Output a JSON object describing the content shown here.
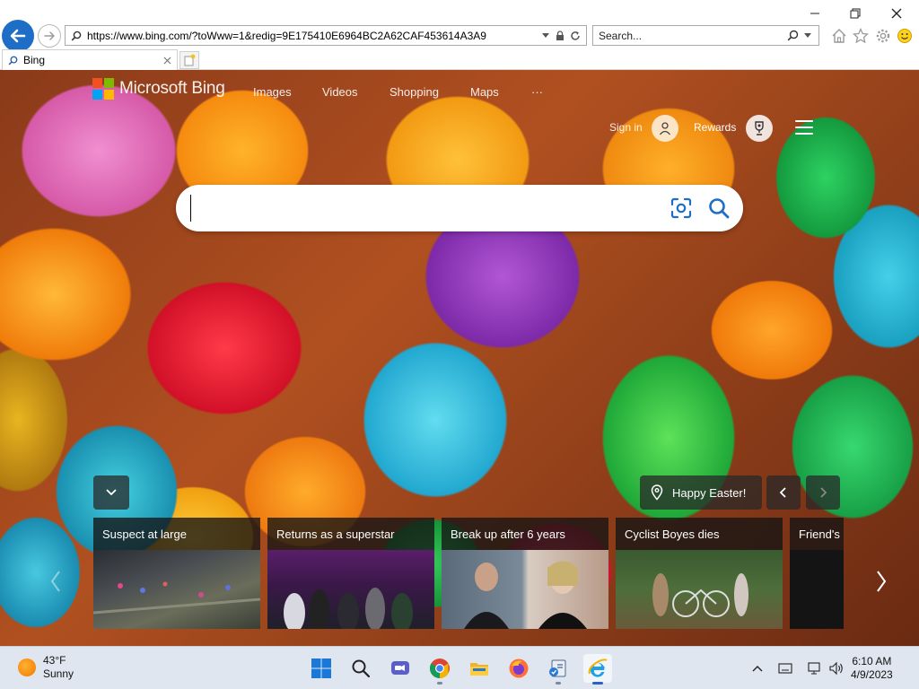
{
  "browser": {
    "url": "https://www.bing.com/?toWww=1&redig=9E175410E6964BC2A62CAF453614A3A9",
    "search_placeholder": "Search...",
    "tab_title": "Bing"
  },
  "bing": {
    "brand": "Microsoft Bing",
    "nav": [
      "Images",
      "Videos",
      "Shopping",
      "Maps",
      "···"
    ],
    "sign_in": "Sign in",
    "rewards": "Rewards",
    "search_value": "",
    "image_caption": "Happy Easter!"
  },
  "news": [
    {
      "title": "Suspect at large"
    },
    {
      "title": "Returns as a superstar"
    },
    {
      "title": "Break up after 6 years"
    },
    {
      "title": "Cyclist Boyes dies"
    },
    {
      "title": "Friend's l"
    }
  ],
  "taskbar": {
    "temperature": "43°F",
    "condition": "Sunny",
    "time": "6:10 AM",
    "date": "4/9/2023"
  },
  "colors": {
    "accent": "#1e6ec8",
    "bing_blue": "#1e6ec8",
    "ms_red": "#f25022",
    "ms_green": "#7fba00",
    "ms_blue": "#00a4ef",
    "ms_yellow": "#ffb900"
  }
}
